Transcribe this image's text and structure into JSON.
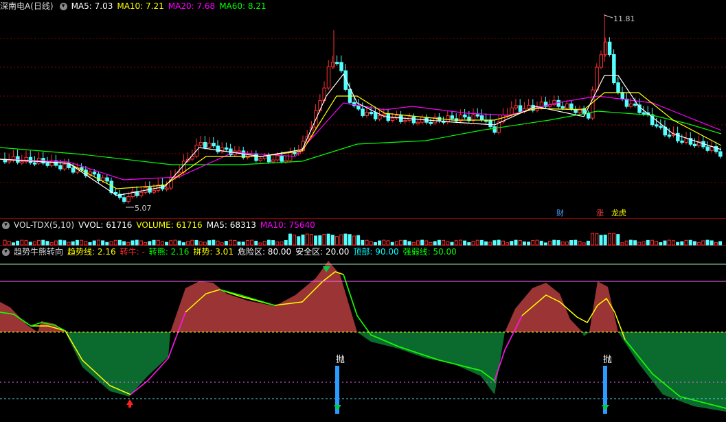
{
  "main_panel": {
    "title": "深南电A(日线)",
    "indicators": [
      {
        "label": "MA5: 7.03",
        "color": "#ffffff"
      },
      {
        "label": "MA10: 7.21",
        "color": "#ffff00"
      },
      {
        "label": "MA20: 7.68",
        "color": "#ff00ff"
      },
      {
        "label": "MA60: 8.21",
        "color": "#00ff00"
      }
    ],
    "high_label": "11.81",
    "low_label": "5.07",
    "tags": [
      {
        "label": "财",
        "color": "#4aa3ff"
      },
      {
        "label": "涨",
        "color": "#ff4040"
      },
      {
        "label": "龙虎",
        "color": "#ffff00"
      }
    ]
  },
  "volume_panel": {
    "title": "VOL-TDX(5,10)",
    "indicators": [
      {
        "label": "VVOL: 61716",
        "color": "#ffffff"
      },
      {
        "label": "VOLUME: 61716",
        "color": "#ffff00"
      },
      {
        "label": "MA5: 68313",
        "color": "#ffffff"
      },
      {
        "label": "MA10: 75640",
        "color": "#ff00ff"
      }
    ]
  },
  "trend_panel": {
    "title": "趋势牛熊转向",
    "indicators": [
      {
        "label": "趋势线: 2.16",
        "color": "#ffff00"
      },
      {
        "label": "转牛: -",
        "color": "#ff3030"
      },
      {
        "label": "转熊: 2.16",
        "color": "#00ff00"
      },
      {
        "label": "拼势: 3.01",
        "color": "#ffff00"
      },
      {
        "label": "危险区: 80.00",
        "color": "#ffffff"
      },
      {
        "label": "安全区: 20.00",
        "color": "#ffffff"
      },
      {
        "label": "顶部: 90.00",
        "color": "#00ffff"
      },
      {
        "label": "强弱线: 50.00",
        "color": "#00ff00"
      }
    ],
    "sell_signals": [
      "抛",
      "抛"
    ]
  },
  "colors": {
    "up": "#ff3030",
    "down": "#54ffff",
    "bull_fill": "#9b3434",
    "bear_fill": "#0b6b2e",
    "grid": "#8b0000"
  }
}
